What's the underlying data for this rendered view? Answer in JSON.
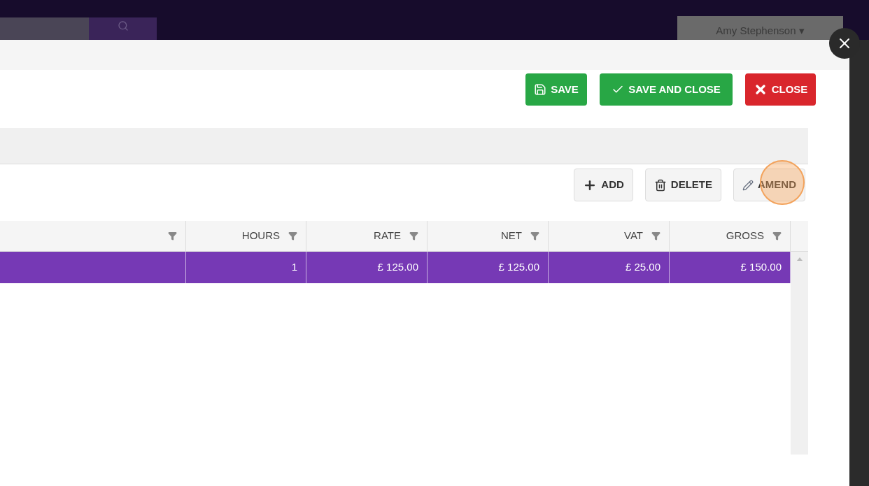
{
  "top_bar": {
    "user_menu": "Amy Stephenson ▾"
  },
  "modal": {
    "actions": [
      {
        "kind": "save",
        "label": "SAVE"
      },
      {
        "kind": "save_close",
        "label": "SAVE AND CLOSE"
      },
      {
        "kind": "close",
        "label": "CLOSE"
      }
    ],
    "toolbar": [
      {
        "kind": "add",
        "label": "ADD"
      },
      {
        "kind": "delete",
        "label": "DELETE"
      },
      {
        "kind": "amend",
        "label": "AMEND",
        "highlighted": true
      }
    ],
    "table": {
      "columns": [
        {
          "kind": "untitled"
        },
        {
          "kind": "titled",
          "label": "HOURS"
        },
        {
          "kind": "titled",
          "label": "RATE"
        },
        {
          "kind": "titled",
          "label": "NET"
        },
        {
          "kind": "titled",
          "label": "VAT"
        },
        {
          "kind": "titled",
          "label": "GROSS"
        }
      ],
      "rows": [
        {
          "selected": true,
          "cells": [
            "",
            "1",
            "£ 125.00",
            "£ 125.00",
            "£ 25.00",
            "£ 150.00"
          ]
        }
      ]
    }
  }
}
